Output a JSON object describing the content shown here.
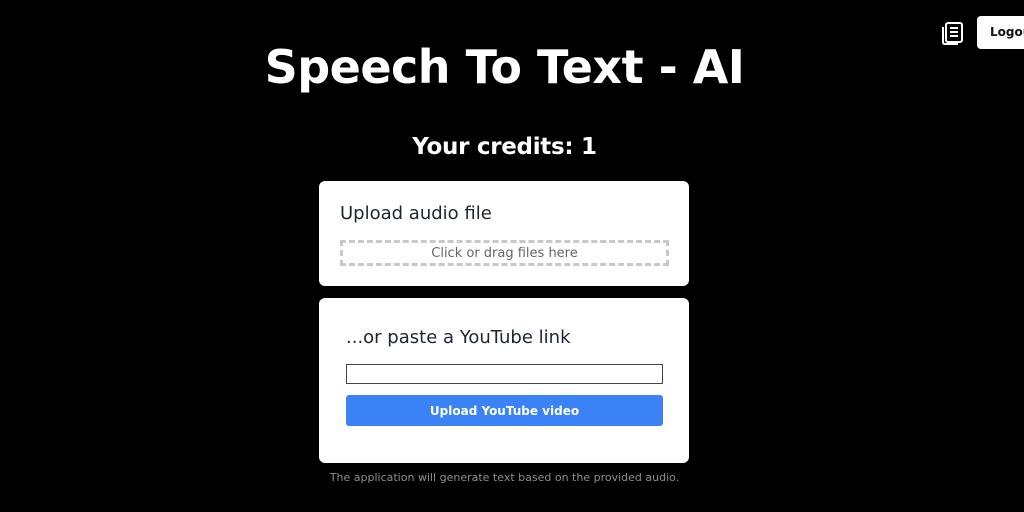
{
  "header": {
    "notes_icon": "document-list-icon",
    "logout_label": "Logout"
  },
  "title": "Speech To Text - AI",
  "credits_text": "Your credits: 1",
  "upload_card": {
    "heading": "Upload audio file",
    "dropzone_text": "Click or drag files here"
  },
  "youtube_card": {
    "heading": "...or paste a YouTube link",
    "input_value": "",
    "input_placeholder": "",
    "button_label": "Upload YouTube video"
  },
  "footnote": "The application will generate text based on the provided audio.",
  "colors": {
    "background": "#000000",
    "card": "#ffffff",
    "accent": "#3b82f6"
  }
}
